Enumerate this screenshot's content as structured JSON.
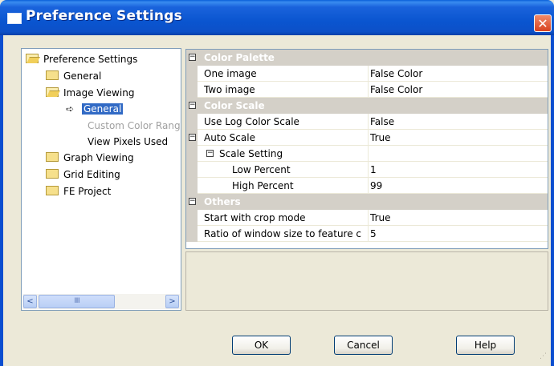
{
  "window": {
    "title": "Preference Settings",
    "close_label": "✕"
  },
  "tree": {
    "items": [
      {
        "label": "Preference Settings",
        "icon": "open-folder-icon"
      },
      {
        "label": "General",
        "icon": "folder-icon"
      },
      {
        "label": "Image Viewing",
        "icon": "open-folder-icon"
      },
      {
        "label": "General",
        "icon": "arrow-right-icon",
        "selected": true
      },
      {
        "label": "Custom Color Rang",
        "disabled": true
      },
      {
        "label": "View Pixels Used"
      },
      {
        "label": "Graph Viewing",
        "icon": "folder-icon"
      },
      {
        "label": "Grid Editing",
        "icon": "folder-icon"
      },
      {
        "label": "FE Project",
        "icon": "folder-icon"
      }
    ],
    "scroll_left": "<",
    "scroll_right": ">",
    "thumb_grip": "IIII"
  },
  "property_grid": {
    "categories": [
      {
        "name": "Color Palette",
        "properties": [
          {
            "name": "One image",
            "value": "False Color"
          },
          {
            "name": "Two image",
            "value": "False Color"
          }
        ]
      },
      {
        "name": "Color Scale",
        "properties": [
          {
            "name": "Use Log Color Scale",
            "value": "False"
          },
          {
            "name": "Auto Scale",
            "value": "True",
            "expandable": true
          },
          {
            "name": "Scale Setting",
            "value": "",
            "expandable": true
          },
          {
            "name": "Low Percent",
            "value": "1"
          },
          {
            "name": "High Percent",
            "value": "99"
          }
        ]
      },
      {
        "name": "Others",
        "properties": [
          {
            "name": "Start with crop mode",
            "value": "True"
          },
          {
            "name": "Ratio of window size to feature c",
            "value": "5"
          }
        ]
      }
    ],
    "collapse_symbol": "−"
  },
  "buttons": {
    "ok": "OK",
    "cancel": "Cancel",
    "help": "Help"
  },
  "colors": {
    "titlebar": "#0a55d0",
    "selection": "#316ac5",
    "category_bg": "#d4d0c8"
  }
}
